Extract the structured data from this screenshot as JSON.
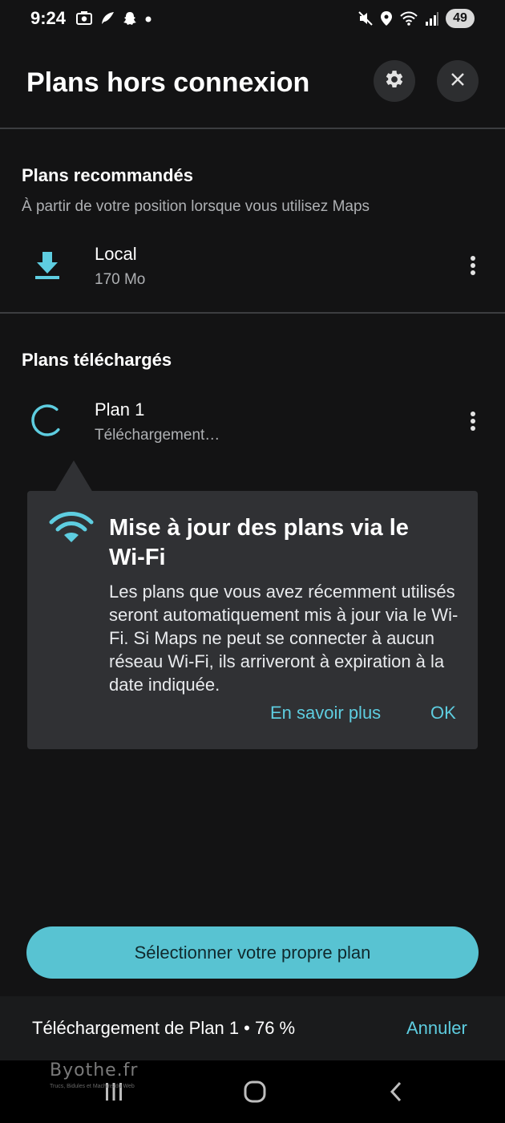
{
  "status_bar": {
    "time": "9:24",
    "battery": "49",
    "left_icons": [
      "screenshot-icon",
      "feather-icon",
      "snapchat-icon",
      "dot-icon"
    ],
    "right_icons": [
      "mute-icon",
      "location-icon",
      "wifi-icon",
      "signal-icon"
    ]
  },
  "header": {
    "title": "Plans hors connexion",
    "settings_icon": "gear-icon",
    "close_icon": "close-icon"
  },
  "recommended": {
    "title": "Plans recommandés",
    "subtitle": "À partir de votre position lorsque vous utilisez Maps",
    "items": [
      {
        "name": "Local",
        "size": "170 Mo",
        "icon": "download-icon"
      }
    ]
  },
  "downloaded": {
    "title": "Plans téléchargés",
    "items": [
      {
        "name": "Plan 1",
        "status": "Téléchargement…",
        "icon": "spinner-icon"
      }
    ]
  },
  "tooltip": {
    "title": "Mise à jour des plans via le Wi-Fi",
    "body": "Les plans que vous avez récemment utilisés seront automatiquement mis à jour via le Wi-Fi. Si Maps ne peut se connecter à aucun réseau Wi-Fi, ils arriveront à expiration à la date indiquée.",
    "learn_more": "En savoir plus",
    "ok": "OK"
  },
  "select_button": "Sélectionner votre propre plan",
  "download_banner": {
    "status": "Téléchargement de Plan 1 • 76 %",
    "cancel": "Annuler"
  },
  "watermark": {
    "text": "Byothe.fr",
    "tagline": "Trucs, Bidules et Machins du Web"
  },
  "colors": {
    "accent": "#5ecde0",
    "button": "#58c3d2",
    "background": "#131314",
    "card": "#303134"
  }
}
